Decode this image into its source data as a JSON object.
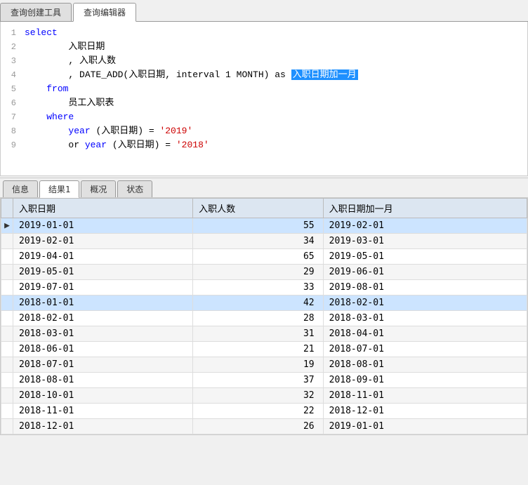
{
  "tabs": {
    "items": [
      {
        "label": "查询创建工具",
        "active": false
      },
      {
        "label": "查询编辑器",
        "active": true
      }
    ]
  },
  "editor": {
    "lines": [
      {
        "num": 1,
        "content": "select",
        "type": "keyword_inline"
      },
      {
        "num": 2,
        "content": "    入职日期",
        "type": "plain"
      },
      {
        "num": 3,
        "content": "    , 入职人数",
        "type": "plain"
      },
      {
        "num": 4,
        "content": "    , DATE_ADD(入职日期, interval 1 MONTH) as ",
        "highlight": "入职日期加一月",
        "type": "highlight"
      },
      {
        "num": 5,
        "content": "from",
        "type": "keyword_standalone"
      },
      {
        "num": 6,
        "content": "    员工入职表",
        "type": "plain"
      },
      {
        "num": 7,
        "content": "where",
        "type": "keyword_standalone"
      },
      {
        "num": 8,
        "content": "    year (入职日期) = ",
        "str": "'2019'",
        "type": "keyword_with_str"
      },
      {
        "num": 9,
        "content": "    or year (入职日期) = ",
        "str": "'2018'",
        "type": "keyword_with_str"
      }
    ]
  },
  "bottom_tabs": {
    "items": [
      {
        "label": "信息",
        "active": false
      },
      {
        "label": "结果1",
        "active": true
      },
      {
        "label": "概况",
        "active": false
      },
      {
        "label": "状态",
        "active": false
      }
    ]
  },
  "table": {
    "columns": [
      "入职日期",
      "入职人数",
      "入职日期加一月"
    ],
    "rows": [
      {
        "indicator": "▶",
        "date": "2019-01-01",
        "count": 55,
        "date_plus": "2019-02-01",
        "selected": true
      },
      {
        "indicator": "",
        "date": "2019-02-01",
        "count": 34,
        "date_plus": "2019-03-01",
        "selected": false
      },
      {
        "indicator": "",
        "date": "2019-04-01",
        "count": 65,
        "date_plus": "2019-05-01",
        "selected": false
      },
      {
        "indicator": "",
        "date": "2019-05-01",
        "count": 29,
        "date_plus": "2019-06-01",
        "selected": false
      },
      {
        "indicator": "",
        "date": "2019-07-01",
        "count": 33,
        "date_plus": "2019-08-01",
        "selected": false
      },
      {
        "indicator": "",
        "date": "2018-01-01",
        "count": 42,
        "date_plus": "2018-02-01",
        "selected": true
      },
      {
        "indicator": "",
        "date": "2018-02-01",
        "count": 28,
        "date_plus": "2018-03-01",
        "selected": false
      },
      {
        "indicator": "",
        "date": "2018-03-01",
        "count": 31,
        "date_plus": "2018-04-01",
        "selected": false
      },
      {
        "indicator": "",
        "date": "2018-06-01",
        "count": 21,
        "date_plus": "2018-07-01",
        "selected": false
      },
      {
        "indicator": "",
        "date": "2018-07-01",
        "count": 19,
        "date_plus": "2018-08-01",
        "selected": false
      },
      {
        "indicator": "",
        "date": "2018-08-01",
        "count": 37,
        "date_plus": "2018-09-01",
        "selected": false
      },
      {
        "indicator": "",
        "date": "2018-10-01",
        "count": 32,
        "date_plus": "2018-11-01",
        "selected": false
      },
      {
        "indicator": "",
        "date": "2018-11-01",
        "count": 22,
        "date_plus": "2018-12-01",
        "selected": false
      },
      {
        "indicator": "",
        "date": "2018-12-01",
        "count": 26,
        "date_plus": "2019-01-01",
        "selected": false
      }
    ]
  }
}
